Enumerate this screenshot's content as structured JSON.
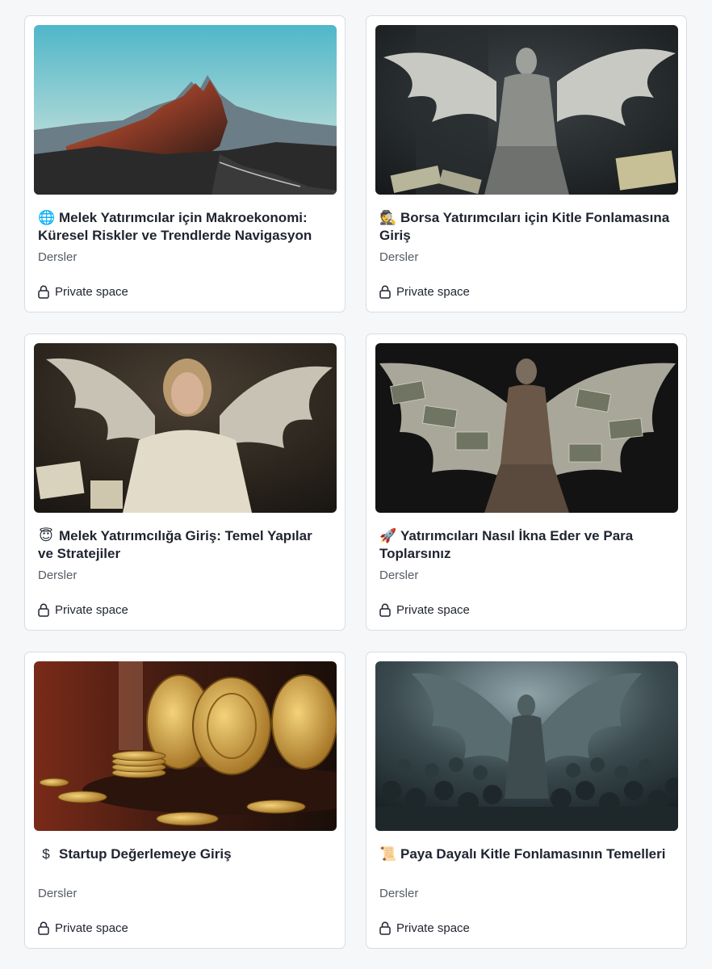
{
  "cards": [
    {
      "emoji": "🌐",
      "emoji_name": "globe-icon",
      "title": "Melek Yatırımcılar için Makroekonomi: Küresel Riskler ve Trendlerde Navigasyon",
      "subtitle": "Dersler",
      "privacy": "Private space",
      "image_name": "mountain-sunset-image"
    },
    {
      "emoji": "🕵",
      "emoji_name": "detective-icon",
      "title": "Borsa Yatırımcıları için Kitle Fonlamasına Giriş",
      "subtitle": "Dersler",
      "privacy": "Private space",
      "image_name": "angel-statue-money-image"
    },
    {
      "emoji": "😇",
      "emoji_name": "halo-face-icon",
      "title": "Melek Yatırımcılığa Giriş: Temel Yapılar ve Stratejiler",
      "subtitle": "Dersler",
      "privacy": "Private space",
      "image_name": "angel-woman-image"
    },
    {
      "emoji": "🚀",
      "emoji_name": "rocket-icon",
      "title": "Yatırımcıları Nasıl İkna Eder ve Para Toplarsınız",
      "subtitle": "Dersler",
      "privacy": "Private space",
      "image_name": "money-wings-angel-image"
    },
    {
      "emoji": "$",
      "emoji_name": "dollar-icon",
      "title": "Startup Değerlemeye Giriş",
      "subtitle": "Dersler",
      "privacy": "Private space",
      "image_name": "gold-coins-image"
    },
    {
      "emoji": "📜",
      "emoji_name": "scroll-icon",
      "title": "Paya Dayalı Kitle Fonlamasının Temelleri",
      "subtitle": "Dersler",
      "privacy": "Private space",
      "image_name": "angel-crowd-image"
    }
  ]
}
